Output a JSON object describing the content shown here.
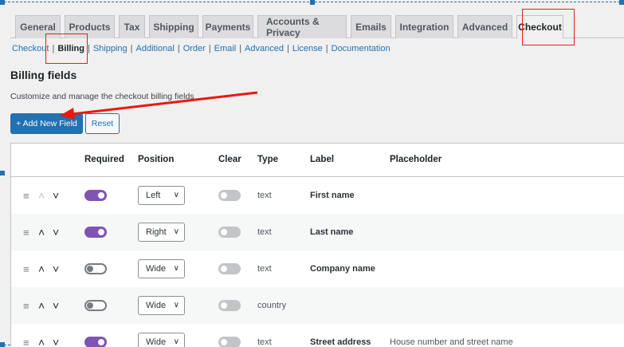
{
  "tabs": [
    {
      "label": "General",
      "active": false
    },
    {
      "label": "Products",
      "active": false
    },
    {
      "label": "Tax",
      "active": false
    },
    {
      "label": "Shipping",
      "active": false
    },
    {
      "label": "Payments",
      "active": false
    },
    {
      "label": "Accounts & Privacy",
      "active": false
    },
    {
      "label": "Emails",
      "active": false
    },
    {
      "label": "Integration",
      "active": false
    },
    {
      "label": "Advanced",
      "active": false
    },
    {
      "label": "Checkout",
      "active": true
    }
  ],
  "subnav": [
    {
      "label": "Checkout",
      "current": false
    },
    {
      "label": "Billing",
      "current": true
    },
    {
      "label": "Shipping",
      "current": false
    },
    {
      "label": "Additional",
      "current": false
    },
    {
      "label": "Order",
      "current": false
    },
    {
      "label": "Email",
      "current": false
    },
    {
      "label": "Advanced",
      "current": false
    },
    {
      "label": "License",
      "current": false
    },
    {
      "label": "Documentation",
      "current": false
    }
  ],
  "page": {
    "title": "Billing fields",
    "description": "Customize and manage the checkout billing fields",
    "add_button": "+ Add New Field",
    "reset_button": "Reset"
  },
  "table": {
    "headers": {
      "required": "Required",
      "position": "Position",
      "clear": "Clear",
      "type": "Type",
      "label": "Label",
      "placeholder": "Placeholder"
    },
    "rows": [
      {
        "required": true,
        "position": "Left",
        "clear": false,
        "type": "text",
        "label": "First name",
        "placeholder": "",
        "up_disabled": true
      },
      {
        "required": true,
        "position": "Right",
        "clear": false,
        "type": "text",
        "label": "Last name",
        "placeholder": "",
        "up_disabled": false
      },
      {
        "required": false,
        "position": "Wide",
        "clear": false,
        "type": "text",
        "label": "Company name",
        "placeholder": "",
        "up_disabled": false
      },
      {
        "required": false,
        "position": "Wide",
        "clear": false,
        "type": "country",
        "label": "",
        "placeholder": "",
        "up_disabled": false
      },
      {
        "required": true,
        "position": "Wide",
        "clear": false,
        "type": "text",
        "label": "Street address",
        "placeholder": "House number and street name",
        "up_disabled": false
      }
    ]
  },
  "colors": {
    "accent": "#2271b1",
    "toggle_on": "#7f54b3",
    "highlight": "#e02020"
  },
  "icons": {
    "drag": "drag-handle-icon",
    "up": "chevron-up-icon",
    "down": "chevron-down-icon"
  }
}
